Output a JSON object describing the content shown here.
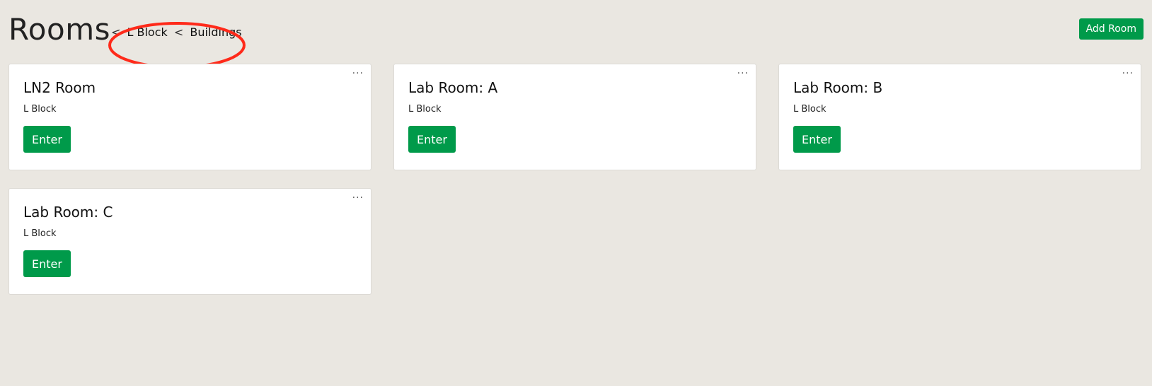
{
  "header": {
    "title": "Rooms",
    "breadcrumb": [
      {
        "sep": "<",
        "label": "L Block"
      },
      {
        "sep": "<",
        "label": "Buildings"
      }
    ],
    "add_room_label": "Add Room"
  },
  "colors": {
    "accent": "#009a4a",
    "background": "#eae7e1",
    "annotation": "#ff2a1a"
  },
  "rooms": [
    {
      "name": "LN2 Room",
      "building": "L Block",
      "enter_label": "Enter",
      "menu": "···"
    },
    {
      "name": "Lab Room: A",
      "building": "L Block",
      "enter_label": "Enter",
      "menu": "···"
    },
    {
      "name": "Lab Room: B",
      "building": "L Block",
      "enter_label": "Enter",
      "menu": "···"
    },
    {
      "name": "Lab Room: C",
      "building": "L Block",
      "enter_label": "Enter",
      "menu": "···"
    }
  ]
}
